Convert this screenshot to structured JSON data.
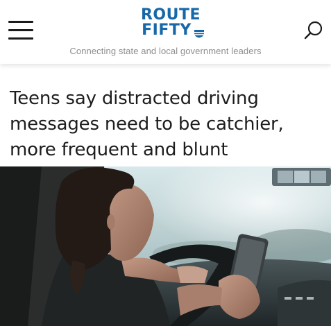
{
  "header": {
    "logo_line1": "ROUTE",
    "logo_line2": "FIFTY",
    "tagline": "Connecting state and local government leaders",
    "menu_icon": "hamburger-menu-icon",
    "search_icon": "search-icon"
  },
  "article": {
    "headline": "Teens say distracted driving messages need to be catchier, more frequent and blunt",
    "image_icon": "teen-driver-texting-photo"
  },
  "colors": {
    "brand_blue": "#1768a8",
    "headline_text": "#1d1d1d",
    "tagline_text": "#8d8d8d"
  }
}
